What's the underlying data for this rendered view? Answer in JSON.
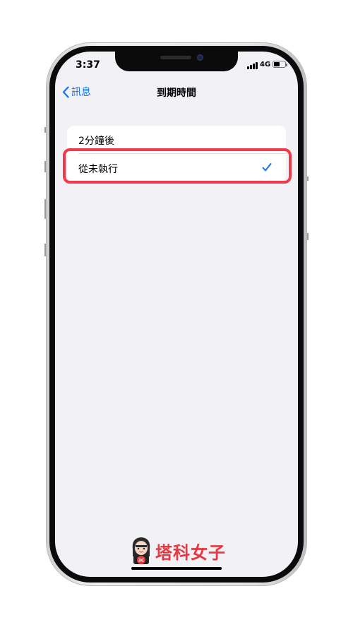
{
  "status_bar": {
    "time": "3:37",
    "network": "4G",
    "battery_level": 0.55
  },
  "nav": {
    "back_label": "訊息",
    "title": "到期時間"
  },
  "options": [
    {
      "label": "2分鐘後",
      "selected": false
    },
    {
      "label": "從未執行",
      "selected": true
    }
  ],
  "colors": {
    "accent": "#1a73e8",
    "highlight": "#f03a4c",
    "background": "#f2f1f6",
    "logo": "#e7373f"
  },
  "watermark": {
    "text": "塔科女子",
    "badge": "3C"
  }
}
